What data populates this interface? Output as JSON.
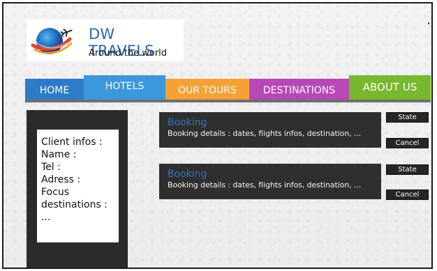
{
  "brand": {
    "title": "DW TRAVELS",
    "subtitle": "Around the world",
    "logo_icon": "globe-airplane-icon"
  },
  "nav": {
    "items": [
      {
        "label": "HOME",
        "color": "#2e7bc9"
      },
      {
        "label": "HOTELS",
        "color": "#3b98dd"
      },
      {
        "label": "OUR TOURS",
        "color": "#f6a136"
      },
      {
        "label": "DESTINATIONS",
        "color": "#b748b6"
      },
      {
        "label": "ABOUT US",
        "color": "#77b82c"
      }
    ]
  },
  "client": {
    "lines": [
      "Client infos :",
      "Name :",
      "Tel :",
      "Adress :",
      "Focus",
      "destinations :",
      "..."
    ]
  },
  "bookings": [
    {
      "title": "Booking",
      "details": "Booking details : dates, flights infos, destination, ...",
      "state_label": "State",
      "cancel_label": "Cancel"
    },
    {
      "title": "Booking",
      "details": "Booking details : dates, flights infos, destination, ...",
      "state_label": "State",
      "cancel_label": "Cancel"
    }
  ]
}
